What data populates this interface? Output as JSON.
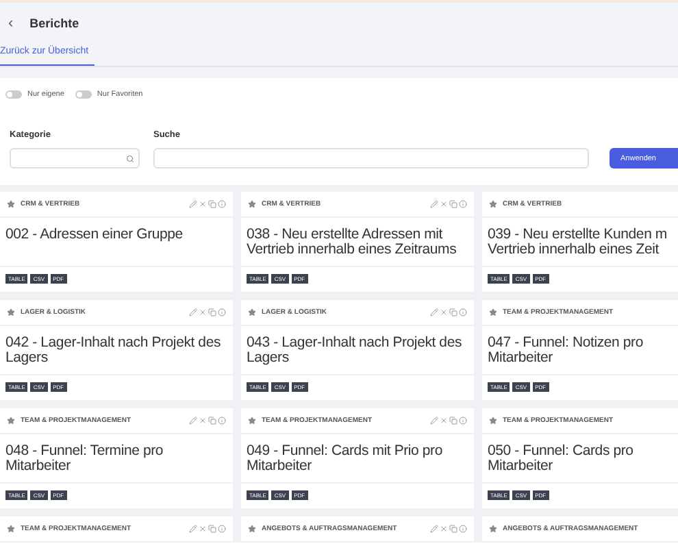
{
  "header": {
    "back": "‹",
    "title": "Berichte"
  },
  "tabs": [
    {
      "label": "Zurück zur Übersicht",
      "selected": true
    }
  ],
  "toggles": [
    {
      "label": "Nur eigene",
      "on": false
    },
    {
      "label": "Nur Favoriten",
      "on": false
    }
  ],
  "filters": {
    "category_label": "Kategorie",
    "search_label": "Suche",
    "apply": "Anwenden"
  },
  "cards": [
    {
      "category": "CRM & VERTRIEB",
      "title": "002 - Adressen einer Gruppe",
      "tags": [
        "TABLE",
        "CSV",
        "PDF"
      ],
      "tools": true
    },
    {
      "category": "CRM & VERTRIEB",
      "title": "038 - Neu erstellte Adressen mit Vertrieb innerhalb eines Zeitraums",
      "tags": [
        "TABLE",
        "CSV",
        "PDF"
      ],
      "tools": true
    },
    {
      "category": "CRM & VERTRIEB",
      "title": "039 - Neu erstellte Kunden m Vertrieb innerhalb eines Zeit",
      "tags": [
        "TABLE",
        "CSV",
        "PDF"
      ],
      "tools": false
    },
    {
      "category": "LAGER & LOGISTIK",
      "title": "042 - Lager-Inhalt nach Projekt des Lagers",
      "tags": [
        "TABLE",
        "CSV",
        "PDF"
      ],
      "tools": true
    },
    {
      "category": "LAGER & LOGISTIK",
      "title": "043 - Lager-Inhalt nach Projekt des Lagers",
      "tags": [
        "TABLE",
        "CSV",
        "PDF"
      ],
      "tools": true
    },
    {
      "category": "TEAM & PROJEKTMANAGEMENT",
      "title": "047 - Funnel: Notizen pro Mitarbeiter",
      "tags": [
        "TABLE",
        "CSV",
        "PDF"
      ],
      "tools": false
    },
    {
      "category": "TEAM & PROJEKTMANAGEMENT",
      "title": "048 - Funnel: Termine pro Mitarbeiter",
      "tags": [
        "TABLE",
        "CSV",
        "PDF"
      ],
      "tools": true
    },
    {
      "category": "TEAM & PROJEKTMANAGEMENT",
      "title": "049 - Funnel: Cards mit Prio pro Mitarbeiter",
      "tags": [
        "TABLE",
        "CSV",
        "PDF"
      ],
      "tools": true
    },
    {
      "category": "TEAM & PROJEKTMANAGEMENT",
      "title": "050 - Funnel: Cards pro Mitarbeiter",
      "tags": [
        "TABLE",
        "CSV",
        "PDF"
      ],
      "tools": false
    },
    {
      "category": "TEAM & PROJEKTMANAGEMENT",
      "tools": true
    },
    {
      "category": "ANGEBOTS & AUFTRAGSMANAGEMENT",
      "tools": true
    },
    {
      "category": "ANGEBOTS & AUFTRAGSMANAGEMENT",
      "tools": false
    }
  ]
}
